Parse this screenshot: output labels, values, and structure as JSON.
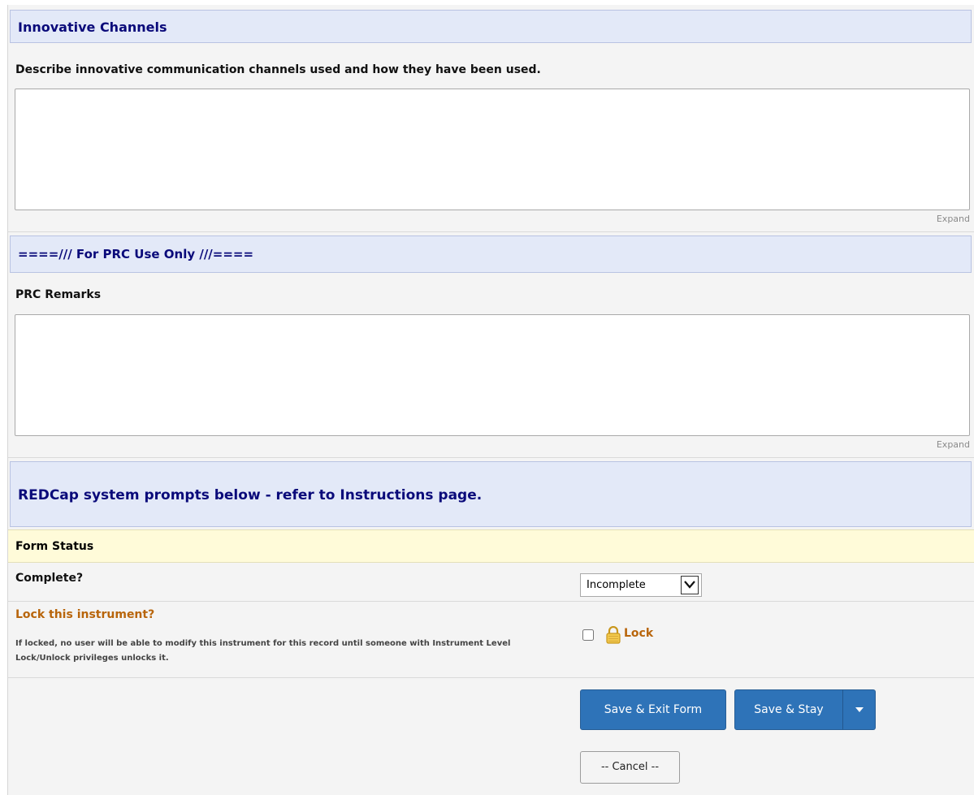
{
  "sections": {
    "innovative": {
      "header": "Innovative Channels",
      "question": "Describe innovative communication channels used and how they have been used.",
      "value": "",
      "expand": "Expand"
    },
    "prc": {
      "header": "====/// For PRC Use Only ///====",
      "question": "PRC Remarks",
      "value": "",
      "expand": "Expand"
    },
    "system": {
      "header": "REDCap system prompts below - refer to Instructions page."
    }
  },
  "form_status": {
    "title": "Form Status",
    "complete_label": "Complete?",
    "complete_value": "Incomplete"
  },
  "lock": {
    "label": "Lock this instrument?",
    "description": "If locked, no user will be able to modify this instrument for this record until someone with Instrument Level Lock/Unlock privileges unlocks it.",
    "checkbox_label": "Lock",
    "checked": false
  },
  "buttons": {
    "save_exit": "Save & Exit Form",
    "save_stay": "Save & Stay",
    "cancel": "-- Cancel --"
  },
  "colors": {
    "header_bg": "#e3e9f8",
    "header_text": "#0a0a7a",
    "primary_button": "#2e73b8",
    "status_bg": "#fffbd9",
    "lock_accent": "#b8650b"
  }
}
